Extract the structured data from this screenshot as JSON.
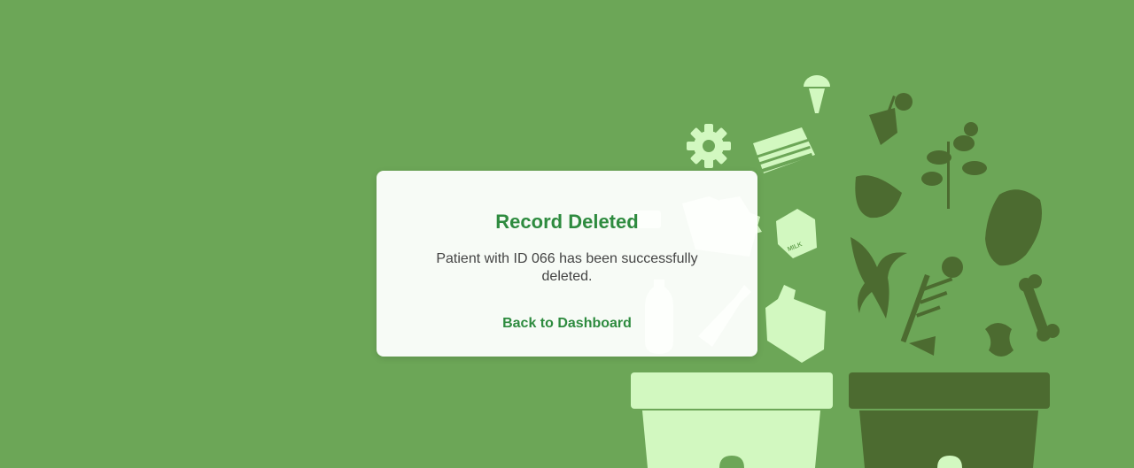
{
  "dialog": {
    "title": "Record Deleted",
    "message": "Patient with ID 066 has been successfully deleted.",
    "back_link": "Back to Dashboard"
  },
  "background": {
    "milk_carton_label": "MILK"
  },
  "colors": {
    "page_background": "#6ca657",
    "accent": "#2e8b3f",
    "recycle_bin": "#d2f8c0",
    "organic_bin": "#4c6b30"
  }
}
